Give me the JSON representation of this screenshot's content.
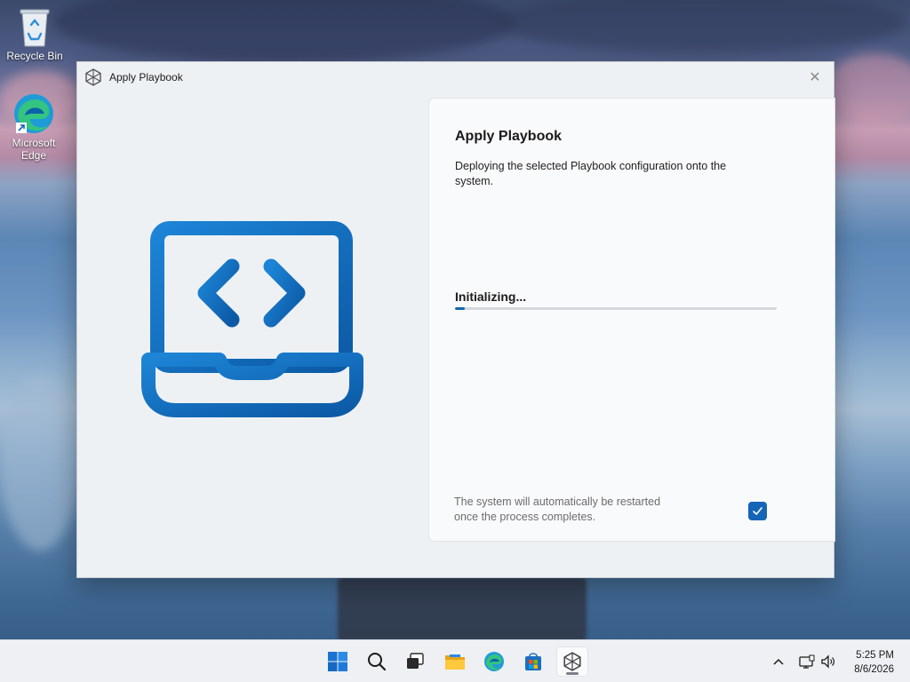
{
  "desktop": {
    "icons": [
      {
        "label": "Recycle Bin"
      },
      {
        "label": "Microsoft Edge"
      }
    ]
  },
  "window": {
    "title": "Apply Playbook",
    "close_glyph": "✕",
    "panel": {
      "heading": "Apply Playbook",
      "description": "Deploying the selected Playbook configuration onto the system.",
      "status": "Initializing...",
      "progress_percent": 3,
      "restart_note": "The system will automatically be restarted once the process completes.",
      "restart_checked": true
    }
  },
  "taskbar": {
    "apps": [
      "start-icon",
      "search-icon",
      "task-view-icon",
      "file-explorer-icon",
      "edge-icon",
      "store-icon",
      "playbook-app-icon"
    ],
    "tray": [
      "chevron-up-icon",
      "network-icon",
      "volume-icon"
    ],
    "clock": {
      "time": "5:25 PM",
      "date": "8/6/2026"
    }
  },
  "colors": {
    "accent": "#1565b7",
    "window_bg": "#eef1f4",
    "panel_bg": "#f9fafb"
  }
}
